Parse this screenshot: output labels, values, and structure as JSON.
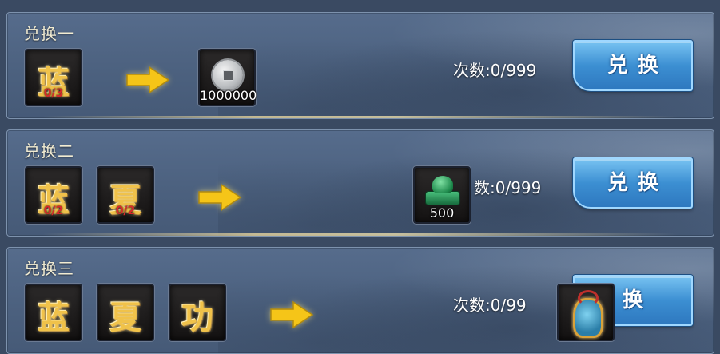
{
  "rows": [
    {
      "title": "兑换一",
      "inputs": [
        {
          "icon": "lan-calligraphy-icon",
          "glyph": "蓝",
          "count": "0/3"
        }
      ],
      "output": {
        "icon": "silver-coin-icon",
        "amount": "1000000"
      },
      "times_text": "次数:0/999",
      "button_label": "兑换"
    },
    {
      "title": "兑换二",
      "inputs": [
        {
          "icon": "lan-calligraphy-icon",
          "glyph": "蓝",
          "count": "0/2"
        },
        {
          "icon": "xia-calligraphy-icon",
          "glyph": "夏",
          "count": "0/2"
        }
      ],
      "output": {
        "icon": "jade-seal-icon",
        "amount": "500"
      },
      "times_text": "数:0/999",
      "button_label": "兑换"
    },
    {
      "title": "兑换三",
      "inputs": [
        {
          "icon": "lan-calligraphy-icon",
          "glyph": "蓝",
          "count": ""
        },
        {
          "icon": "xia-calligraphy-icon",
          "glyph": "夏",
          "count": ""
        },
        {
          "icon": "gong-calligraphy-icon",
          "glyph": "功",
          "count": ""
        }
      ],
      "output": {
        "icon": "ornate-mirror-icon",
        "amount": ""
      },
      "times_text": "次数:0/99",
      "button_label": "换"
    }
  ],
  "colors": {
    "panel": "#4f6484",
    "title_text": "#f2ecd2",
    "count_red": "#d82a2a",
    "button_blue": "#3c8fd2",
    "arrow_yellow": "#f5c518"
  }
}
